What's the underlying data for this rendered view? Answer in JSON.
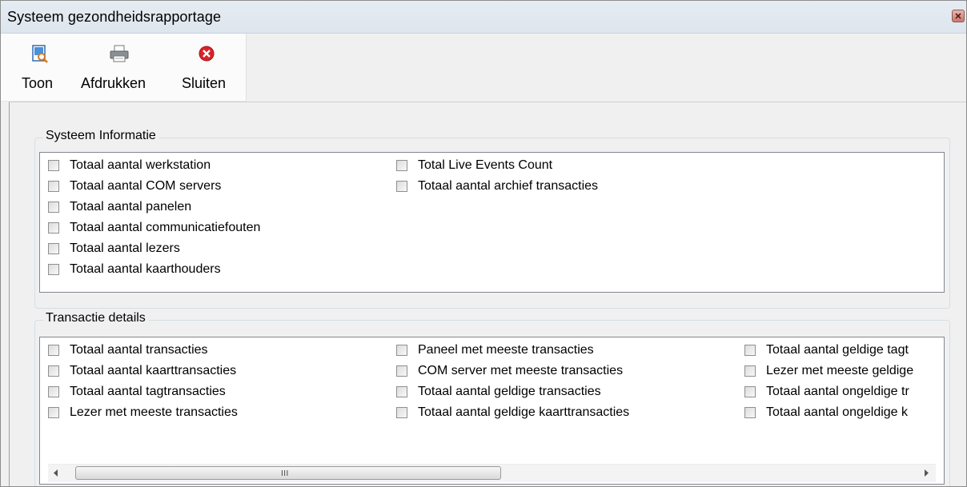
{
  "window": {
    "title": "Systeem gezondheidsrapportage"
  },
  "toolbar": {
    "buttons": [
      {
        "label": "Toon",
        "icon": "report-preview-icon"
      },
      {
        "label": "Afdrukken",
        "icon": "printer-icon"
      },
      {
        "label": "Sluiten",
        "icon": "close-red-icon"
      }
    ]
  },
  "system_info": {
    "title": "Systeem Informatie",
    "items": [
      {
        "label": "Totaal aantal werkstation",
        "checked": false
      },
      {
        "label": "Totaal aantal COM servers",
        "checked": false
      },
      {
        "label": "Totaal aantal panelen",
        "checked": false
      },
      {
        "label": "Totaal aantal communicatiefouten",
        "checked": false
      },
      {
        "label": "Totaal aantal lezers",
        "checked": false
      },
      {
        "label": "Totaal aantal kaarthouders",
        "checked": false
      },
      {
        "label": "Total Live Events Count",
        "checked": false
      },
      {
        "label": "Totaal aantal archief transacties",
        "checked": false
      }
    ]
  },
  "transaction_details": {
    "title": "Transactie details",
    "items": [
      {
        "label": "Totaal aantal transacties",
        "checked": false
      },
      {
        "label": "Totaal aantal kaarttransacties",
        "checked": false
      },
      {
        "label": "Totaal aantal tagtransacties",
        "checked": false
      },
      {
        "label": "Lezer met meeste transacties",
        "checked": false
      },
      {
        "label": "Paneel met meeste transacties",
        "checked": false
      },
      {
        "label": "COM server met meeste transacties",
        "checked": false
      },
      {
        "label": "Totaal aantal geldige transacties",
        "checked": false
      },
      {
        "label": "Totaal aantal geldige kaarttransacties",
        "checked": false
      },
      {
        "label": "Totaal aantal geldige tagt",
        "checked": false
      },
      {
        "label": "Lezer met meeste geldige",
        "checked": false
      },
      {
        "label": "Totaal aantal ongeldige tr",
        "checked": false
      },
      {
        "label": "Totaal aantal ongeldige k",
        "checked": false
      }
    ],
    "scrollbar": {
      "grip": "III"
    }
  },
  "colors": {
    "titlebar": "#e6ecf2",
    "listbox_border": "#828790",
    "close_red": "#d9232a"
  }
}
